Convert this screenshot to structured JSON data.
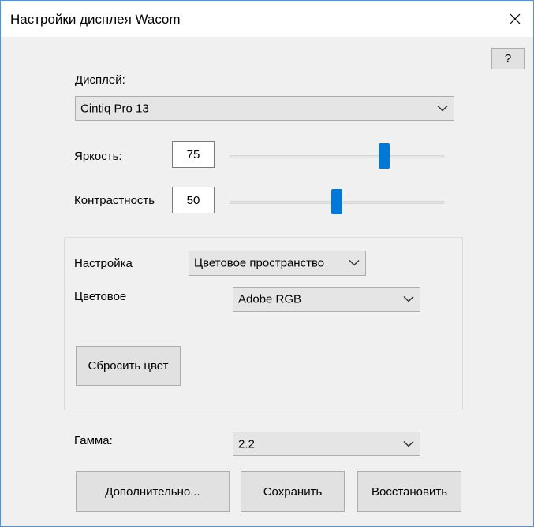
{
  "window": {
    "title": "Настройки дисплея Wacom",
    "close_symbol": "✕"
  },
  "help_button": {
    "label": "?"
  },
  "display": {
    "label": "Дисплей:",
    "selected": "Cintiq Pro 13"
  },
  "brightness": {
    "label": "Яркость:",
    "value": "75",
    "level": 0.72
  },
  "contrast": {
    "label": "Контрастность",
    "value": "50",
    "level": 0.5
  },
  "group": {
    "setting_label": "Настройка",
    "setting_selected": "Цветовое пространство",
    "color_label": "Цветовое",
    "color_selected": "Adobe RGB",
    "reset_button": "Сбросить цвет"
  },
  "gamma": {
    "label": "Гамма:",
    "selected": "2.2"
  },
  "footer": {
    "advanced_button": "Дополнительно...",
    "save_button": "Сохранить",
    "restore_button": "Восстановить"
  },
  "colors": {
    "accent": "#0078d7",
    "window_border": "#5a8fd0"
  }
}
